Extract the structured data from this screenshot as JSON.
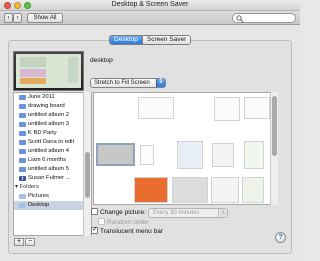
{
  "window": {
    "title": "Desktop & Screen Saver"
  },
  "toolbar": {
    "show_all_label": "Show All",
    "search_placeholder": ""
  },
  "tabs": [
    {
      "label": "Desktop",
      "active": true
    },
    {
      "label": "Screen Saver",
      "active": false
    }
  ],
  "desktop": {
    "current_name": "desktop",
    "fill_mode": "Stretch to Fill Screen"
  },
  "sidebar": {
    "items": [
      {
        "label": "June 2011",
        "icon": "photo-album-icon"
      },
      {
        "label": "drawing board",
        "icon": "photo-album-icon"
      },
      {
        "label": "untitled album 2",
        "icon": "photo-album-icon"
      },
      {
        "label": "untitled album 3",
        "icon": "photo-album-icon"
      },
      {
        "label": "K BD Party",
        "icon": "photo-album-icon"
      },
      {
        "label": "Scott Dana to edit",
        "icon": "photo-album-icon"
      },
      {
        "label": "untitled album 4",
        "icon": "photo-album-icon"
      },
      {
        "label": "Liam 6 months",
        "icon": "photo-album-icon"
      },
      {
        "label": "untitled album 5",
        "icon": "photo-album-icon"
      },
      {
        "label": "Susan Fulmer ...",
        "icon": "facebook-icon"
      }
    ],
    "folders_header": "Folders",
    "folders": [
      {
        "label": "Pictures",
        "icon": "folder-icon"
      },
      {
        "label": "Desktop",
        "icon": "folder-icon",
        "selected": true
      }
    ]
  },
  "buttons": {
    "add": "+",
    "remove": "−"
  },
  "options": {
    "change_picture_label": "Change picture:",
    "change_picture_checked": false,
    "interval": "Every 30 minutes",
    "random_order_label": "Random order",
    "random_order_checked": false,
    "translucent_label": "Translucent menu bar",
    "translucent_checked": true
  },
  "help_label": "?",
  "colors": {
    "accent": "#2f79d8",
    "selection": "#3875d7"
  }
}
